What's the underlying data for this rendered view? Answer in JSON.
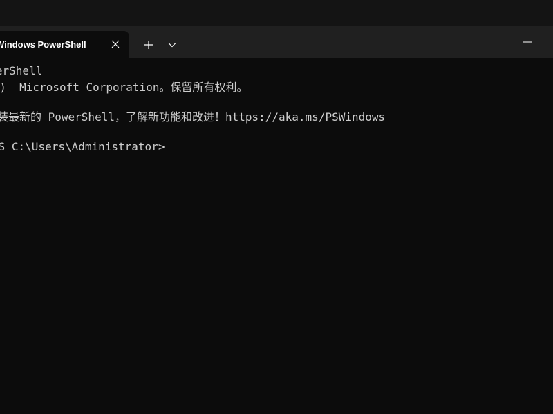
{
  "window": {
    "tab_title": "Windows PowerShell",
    "icons": {
      "close": "close-icon",
      "new_tab": "plus-icon",
      "dropdown": "chevron-down-icon",
      "minimize": "minimize-icon"
    }
  },
  "terminal": {
    "lines": [
      "PowerShell",
      "(C)  Microsoft Corporation。保留所有权利。",
      "安装最新的 PowerShell，了解新功能和改进！https://aka.ms/PSWindows",
      "PS C:\\Users\\Administrator>"
    ]
  },
  "colors": {
    "background": "#0c0c0c",
    "titlebar": "#202020",
    "text": "#cccccc"
  }
}
